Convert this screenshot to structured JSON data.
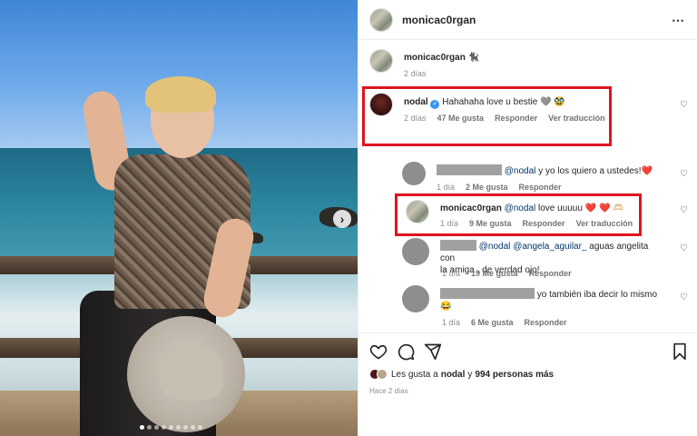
{
  "post": {
    "author": "monicac0rgan",
    "caption_author": "monicac0rgan",
    "caption_emoji": "🐈‍⬛",
    "caption_time": "2 días",
    "carousel_next": "›",
    "carousel_dots": 9,
    "carousel_active": 0
  },
  "comments": [
    {
      "user": "nodal",
      "verified": true,
      "text": "Hahahaha love u bestie 🩶 🥸",
      "time": "2 días",
      "likes": "47 Me gusta",
      "reply": "Responder",
      "translate": "Ver traducción"
    },
    {
      "user_hidden": true,
      "mention": "@nodal",
      "text": "y yo los quiero a ustedes!❤️",
      "time": "1 día",
      "likes": "2 Me gusta",
      "reply": "Responder"
    },
    {
      "user": "monicac0rgan",
      "mention": "@nodal",
      "text": "love uuuuu ❤️ ❤️ 🫶🏻",
      "time": "1 día",
      "likes": "9 Me gusta",
      "reply": "Responder",
      "translate": "Ver traducción"
    },
    {
      "user_hidden": true,
      "mention": "@nodal",
      "mention2": "@angela_aguilar_",
      "text": "aguas angelita con",
      "text2": "la amiga , de verdad ojo!",
      "time": "1 día",
      "likes": "19 Me gusta",
      "reply": "Responder"
    },
    {
      "user_hidden": true,
      "text": "yo también iba decir lo mismo",
      "text2": "😂",
      "time": "1 día",
      "likes": "6 Me gusta",
      "reply": "Responder"
    }
  ],
  "footer": {
    "likes_prefix": "Les gusta a",
    "likes_user": "nodal",
    "likes_mid": "y",
    "likes_count": "994 personas más",
    "ago": "Hace 2 días"
  },
  "icons": {
    "more": "⋯",
    "heart": "♡"
  },
  "colors": {
    "highlight": "#e0131f",
    "verified": "#3897f0",
    "mention": "#00376b"
  }
}
